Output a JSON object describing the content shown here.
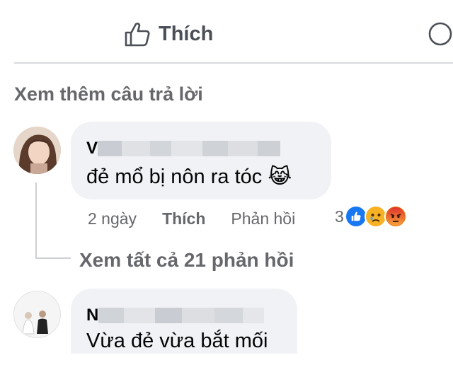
{
  "actions": {
    "like_label": "Thích"
  },
  "more_replies_label": "Xem thêm câu trả lời",
  "comments": [
    {
      "author_initial": "V",
      "text": "đẻ mổ bị nôn ra tóc",
      "emoji": "😹",
      "time": "2 ngày",
      "like_label": "Thích",
      "reply_label": "Phản hồi",
      "reaction_count": "3",
      "reactions": [
        "like-icon",
        "sad-icon",
        "angry-icon"
      ]
    },
    {
      "author_initial": "N",
      "text": "Vừa đẻ vừa bắt mối"
    }
  ],
  "view_all_label": "Xem tất cả 21 phản hồi",
  "colors": {
    "like_blue": "#1877f2",
    "sad_yellow": "#f7b125",
    "angry_red": "#e9710f",
    "secondary_text": "#65676b",
    "bubble_bg": "#f0f2f5"
  }
}
